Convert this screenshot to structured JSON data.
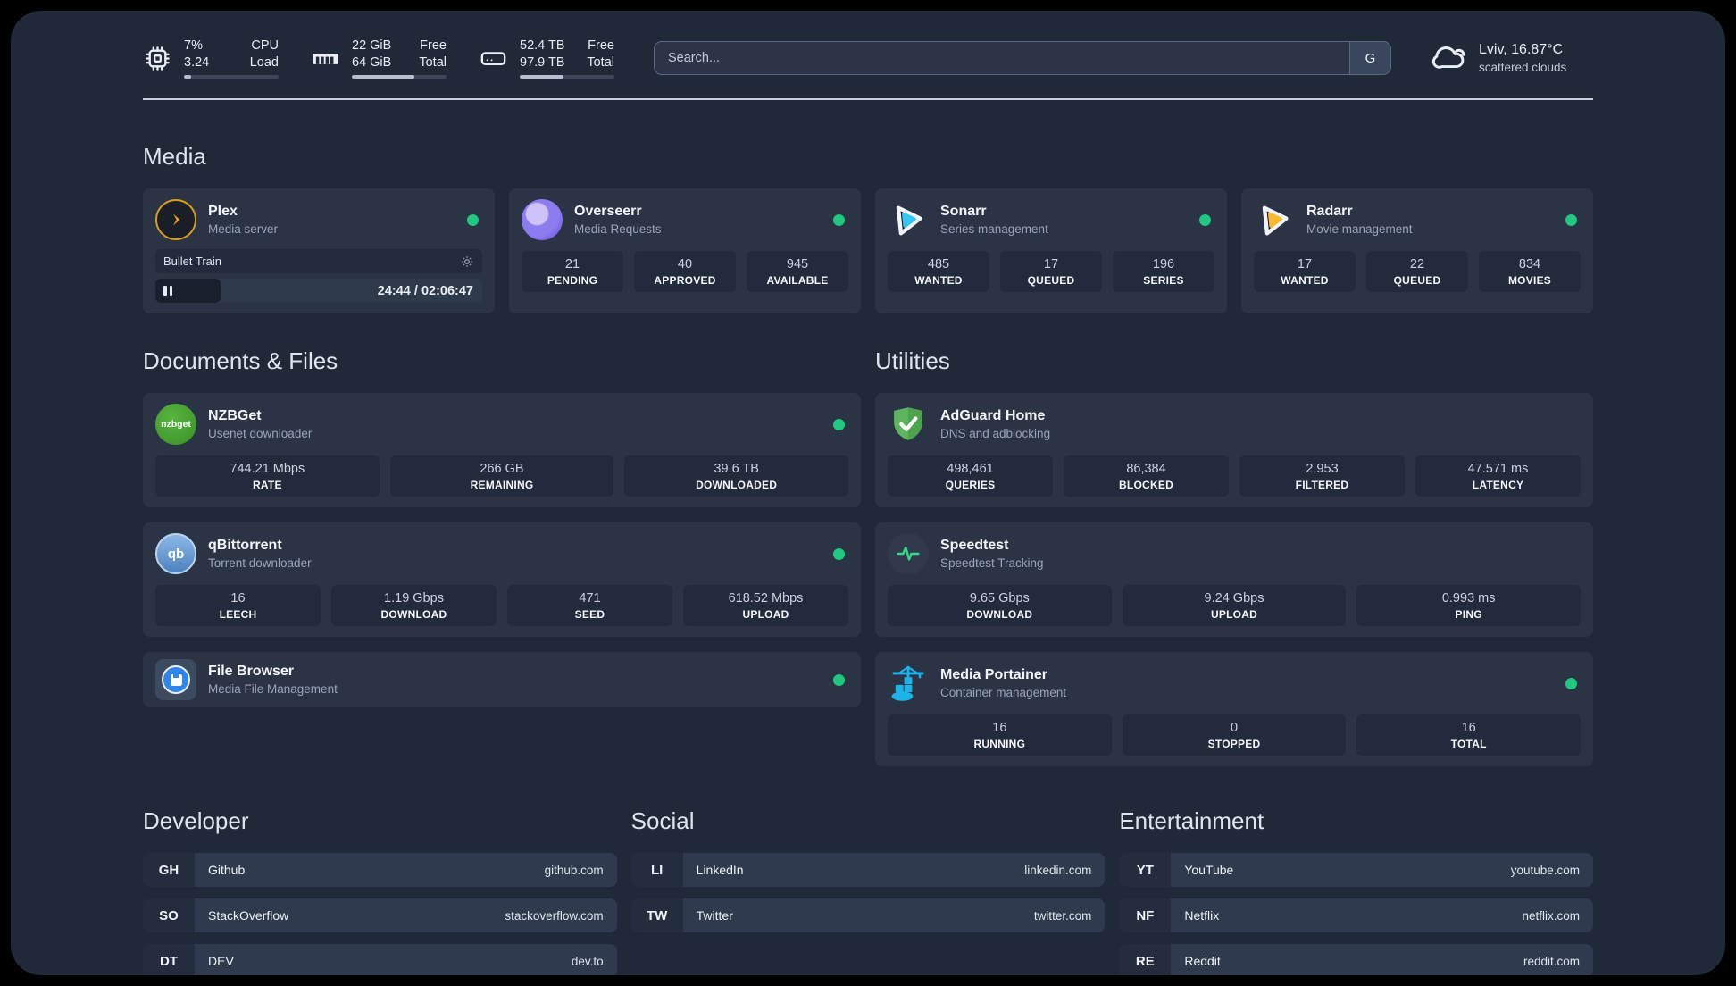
{
  "colors": {
    "status_ok": "#1fc97f",
    "accent_sonarr": "#38c6f2",
    "accent_radarr": "#fdb92e",
    "accent_portainer": "#1db4ea",
    "accent_adguard": "#5db65d",
    "accent_plex": "#e9a21b"
  },
  "header": {
    "system": [
      {
        "icon": "cpu-icon",
        "col1_top": "7%",
        "col1_bottom": "3.24",
        "col2_top": "CPU",
        "col2_bottom": "Load",
        "progress": 8
      },
      {
        "icon": "memory-icon",
        "col1_top": "22 GiB",
        "col1_bottom": "64 GiB",
        "col2_top": "Free",
        "col2_bottom": "Total",
        "progress": 66
      },
      {
        "icon": "disk-icon",
        "col1_top": "52.4 TB",
        "col1_bottom": "97.9 TB",
        "col2_top": "Free",
        "col2_bottom": "Total",
        "progress": 46
      }
    ],
    "search": {
      "placeholder": "Search...",
      "engine_label": "G"
    },
    "weather": {
      "location": "Lviv, 16.87°C",
      "condition": "scattered clouds"
    }
  },
  "media": {
    "title": "Media",
    "plex": {
      "name": "Plex",
      "desc": "Media server",
      "now_playing": {
        "title": "Bullet Train",
        "time": "24:44 / 02:06:47",
        "progress_pct": 20
      }
    },
    "overseerr": {
      "name": "Overseerr",
      "desc": "Media Requests",
      "stats": [
        {
          "value": "21",
          "label": "PENDING"
        },
        {
          "value": "40",
          "label": "APPROVED"
        },
        {
          "value": "945",
          "label": "AVAILABLE"
        }
      ]
    },
    "sonarr": {
      "name": "Sonarr",
      "desc": "Series management",
      "stats": [
        {
          "value": "485",
          "label": "WANTED"
        },
        {
          "value": "17",
          "label": "QUEUED"
        },
        {
          "value": "196",
          "label": "SERIES"
        }
      ]
    },
    "radarr": {
      "name": "Radarr",
      "desc": "Movie management",
      "stats": [
        {
          "value": "17",
          "label": "WANTED"
        },
        {
          "value": "22",
          "label": "QUEUED"
        },
        {
          "value": "834",
          "label": "MOVIES"
        }
      ]
    }
  },
  "documents": {
    "title": "Documents & Files",
    "nzbget": {
      "name": "NZBGet",
      "desc": "Usenet downloader",
      "logo_text": "nzbget",
      "stats": [
        {
          "value": "744.21 Mbps",
          "label": "RATE"
        },
        {
          "value": "266 GB",
          "label": "REMAINING"
        },
        {
          "value": "39.6 TB",
          "label": "DOWNLOADED"
        }
      ]
    },
    "qbittorrent": {
      "name": "qBittorrent",
      "desc": "Torrent downloader",
      "logo_text": "qb",
      "stats": [
        {
          "value": "16",
          "label": "LEECH"
        },
        {
          "value": "1.19 Gbps",
          "label": "DOWNLOAD"
        },
        {
          "value": "471",
          "label": "SEED"
        },
        {
          "value": "618.52 Mbps",
          "label": "UPLOAD"
        }
      ]
    },
    "filebrowser": {
      "name": "File Browser",
      "desc": "Media File Management"
    }
  },
  "utilities": {
    "title": "Utilities",
    "adguard": {
      "name": "AdGuard Home",
      "desc": "DNS and adblocking",
      "stats": [
        {
          "value": "498,461",
          "label": "QUERIES"
        },
        {
          "value": "86,384",
          "label": "BLOCKED"
        },
        {
          "value": "2,953",
          "label": "FILTERED"
        },
        {
          "value": "47.571 ms",
          "label": "LATENCY"
        }
      ]
    },
    "speedtest": {
      "name": "Speedtest",
      "desc": "Speedtest Tracking",
      "stats": [
        {
          "value": "9.65 Gbps",
          "label": "DOWNLOAD"
        },
        {
          "value": "9.24 Gbps",
          "label": "UPLOAD"
        },
        {
          "value": "0.993 ms",
          "label": "PING"
        }
      ]
    },
    "portainer": {
      "name": "Media Portainer",
      "desc": "Container management",
      "stats": [
        {
          "value": "16",
          "label": "RUNNING"
        },
        {
          "value": "0",
          "label": "STOPPED"
        },
        {
          "value": "16",
          "label": "TOTAL"
        }
      ]
    }
  },
  "bookmarks": {
    "developer": {
      "title": "Developer",
      "links": [
        {
          "abbr": "GH",
          "name": "Github",
          "url": "github.com"
        },
        {
          "abbr": "SO",
          "name": "StackOverflow",
          "url": "stackoverflow.com"
        },
        {
          "abbr": "DT",
          "name": "DEV",
          "url": "dev.to"
        }
      ]
    },
    "social": {
      "title": "Social",
      "links": [
        {
          "abbr": "LI",
          "name": "LinkedIn",
          "url": "linkedin.com"
        },
        {
          "abbr": "TW",
          "name": "Twitter",
          "url": "twitter.com"
        }
      ]
    },
    "entertainment": {
      "title": "Entertainment",
      "links": [
        {
          "abbr": "YT",
          "name": "YouTube",
          "url": "youtube.com"
        },
        {
          "abbr": "NF",
          "name": "Netflix",
          "url": "netflix.com"
        },
        {
          "abbr": "RE",
          "name": "Reddit",
          "url": "reddit.com"
        }
      ]
    }
  }
}
